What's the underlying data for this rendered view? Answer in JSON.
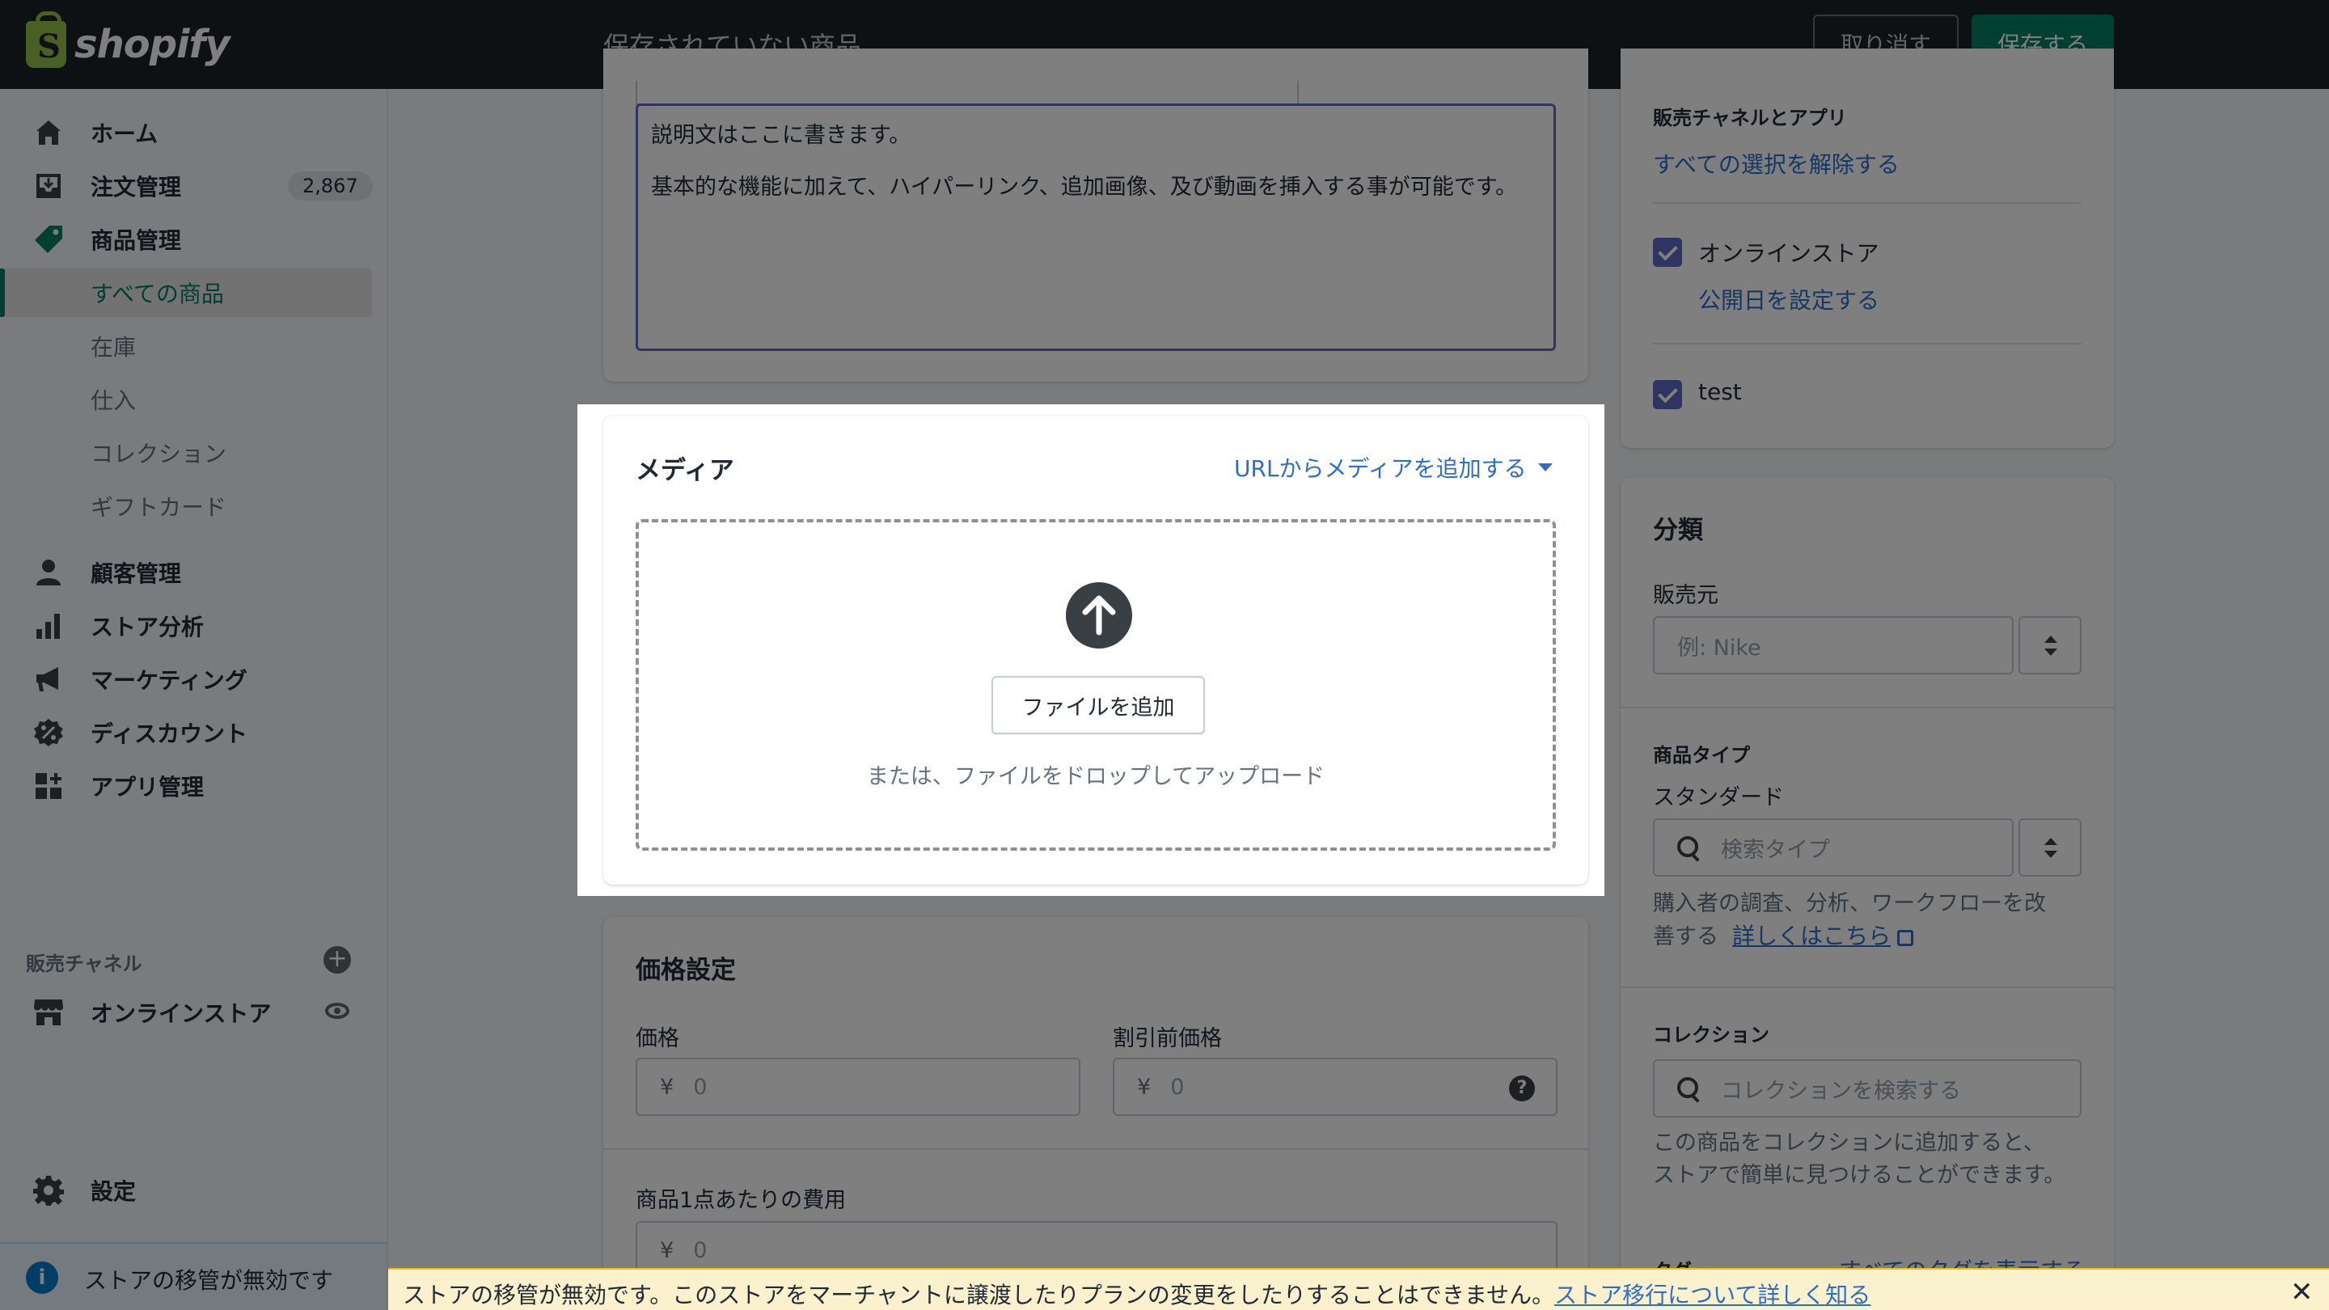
{
  "topbar": {
    "logo_text": "shopify",
    "title": "保存されていない商品",
    "discard_label": "取り消す",
    "save_label": "保存する"
  },
  "sidebar": {
    "items": [
      {
        "label": "ホーム",
        "icon": "home-icon"
      },
      {
        "label": "注文管理",
        "icon": "orders-icon",
        "badge": "2,867"
      },
      {
        "label": "商品管理",
        "icon": "tag-icon"
      },
      {
        "label": "すべての商品",
        "sub": true,
        "active": true
      },
      {
        "label": "在庫",
        "sub": true
      },
      {
        "label": "仕入",
        "sub": true
      },
      {
        "label": "コレクション",
        "sub": true
      },
      {
        "label": "ギフトカード",
        "sub": true
      },
      {
        "label": "顧客管理",
        "icon": "person-icon"
      },
      {
        "label": "ストア分析",
        "icon": "bar-chart-icon"
      },
      {
        "label": "マーケティング",
        "icon": "megaphone-icon"
      },
      {
        "label": "ディスカウント",
        "icon": "discount-icon"
      },
      {
        "label": "アプリ管理",
        "icon": "apps-icon"
      }
    ],
    "channels_heading": "販売チャネル",
    "online_store": "オンラインストア",
    "settings": "設定",
    "migration_notice": "ストアの移管が無効です"
  },
  "description": {
    "line1": "説明文はここに書きます。",
    "line2": "基本的な機能に加えて、ハイパーリンク、追加画像、及び動画を挿入する事が可能です。"
  },
  "media": {
    "title": "メディア",
    "url_link": "URLからメディアを追加する",
    "add_file": "ファイルを追加",
    "drop_hint": "または、ファイルをドロップしてアップロード"
  },
  "pricing": {
    "title": "価格設定",
    "price_label": "価格",
    "compare_label": "割引前価格",
    "cost_label": "商品1点あたりの費用",
    "currency": "¥",
    "price_placeholder": "0",
    "compare_placeholder": "0",
    "cost_placeholder": "0"
  },
  "channels": {
    "heading": "販売チャネルとアプリ",
    "deselect_all": "すべての選択を解除する",
    "online_store": "オンラインストア",
    "set_date": "公開日を設定する",
    "test": "test"
  },
  "organization": {
    "title": "分類",
    "vendor_label": "販売元",
    "vendor_placeholder": "例: Nike",
    "type_heading": "商品タイプ",
    "type_value": "スタンダード",
    "type_placeholder": "検索タイプ",
    "type_help_1": "購入者の調査、分析、ワークフローを改",
    "type_help_2": "善する",
    "type_help_link": "詳しくはこちら",
    "collections_heading": "コレクション",
    "collections_placeholder": "コレクションを検索する",
    "collections_help_1": "この商品をコレクションに追加すると、",
    "collections_help_2": "ストアで簡単に見つけることができます。",
    "tags_heading": "タグ",
    "tags_link": "すべてのタグを表示する"
  },
  "banner": {
    "text": "ストアの移管が無効です。このストアをマーチャントに譲渡したりプランの変更をしたりすることはできません。",
    "link": "ストア移行について詳しく知る"
  },
  "colors": {
    "accent": "#008060",
    "link": "#2c6ecb",
    "checkbox": "#5c6ac4",
    "banner_bg": "#fcf1cd"
  }
}
